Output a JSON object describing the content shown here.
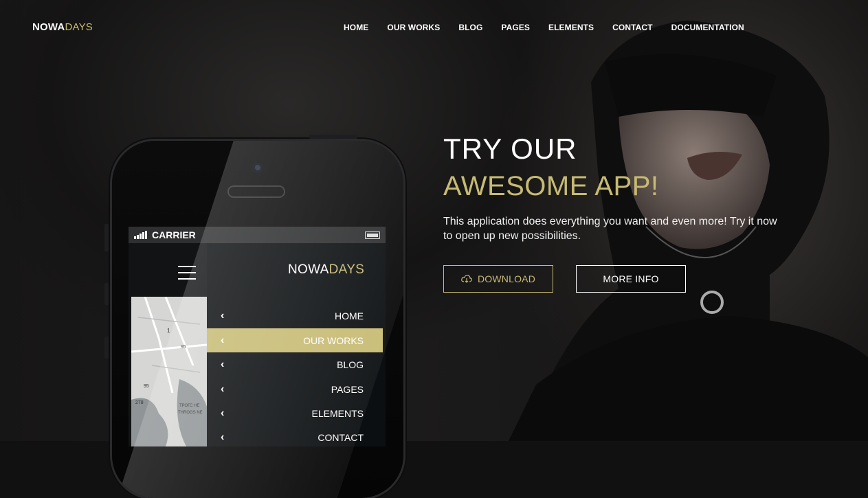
{
  "header": {
    "logo_a": "NOWA",
    "logo_b": "DAYS",
    "nav": [
      "HOME",
      "OUR WORKS",
      "BLOG",
      "PAGES",
      "ELEMENTS",
      "CONTACT",
      "DOCUMENTATION"
    ]
  },
  "hero": {
    "line1": "TRY OUR",
    "line2": "AWESOME APP!",
    "description": "This application does everything you want and even more! Try it now to open up new possibilities.",
    "download_label": "DOWNLOAD",
    "download_icon": "cloud-download-icon",
    "more_label": "MORE INFO"
  },
  "phone": {
    "carrier": "CARRIER",
    "logo_a": "NOWA",
    "logo_b": "DAYS",
    "menu": [
      "HOME",
      "OUR WORKS",
      "BLOG",
      "PAGES",
      "ELEMENTS",
      "CONTACT"
    ],
    "active_index": 1,
    "map_labels": [
      "1",
      "95",
      "95",
      "278",
      "ТРОГС НЕ",
      "THROGS NE"
    ]
  },
  "colors": {
    "accent": "#c7bb73",
    "background": "#111111"
  }
}
